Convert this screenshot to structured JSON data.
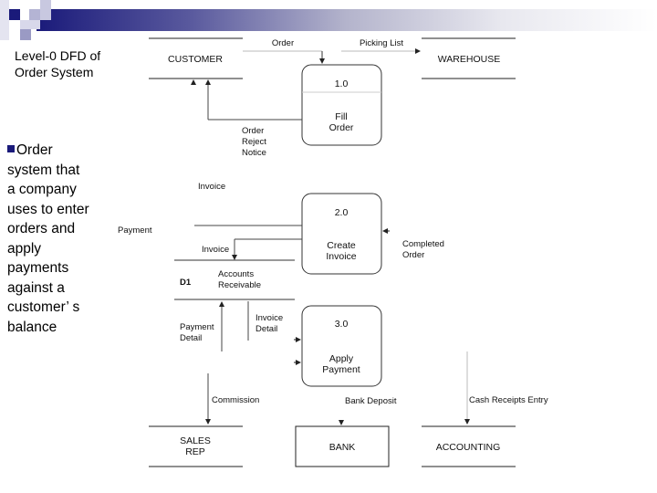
{
  "slide": {
    "title_line1": "Level-0 DFD of",
    "title_line2": "Order System",
    "bullet": "Order system that a company uses to enter orders and apply payments against a customer’ s balance",
    "colors": {
      "accent": "#1a1a7a",
      "line": "#444444"
    }
  },
  "diagram": {
    "entities": {
      "customer": "CUSTOMER",
      "warehouse": "WAREHOUSE",
      "sales_rep_1": "SALES",
      "sales_rep_2": "REP",
      "bank": "BANK",
      "accounting": "ACCOUNTING"
    },
    "processes": [
      {
        "id": "1.0",
        "name1": "Fill",
        "name2": "Order"
      },
      {
        "id": "2.0",
        "name1": "Create",
        "name2": "Invoice"
      },
      {
        "id": "3.0",
        "name1": "Apply",
        "name2": "Payment"
      }
    ],
    "datastore": {
      "id": "D1",
      "name1": "Accounts",
      "name2": "Receivable"
    },
    "flows": {
      "order": "Order",
      "picking_list": "Picking List",
      "order_reject_1": "Order",
      "order_reject_2": "Reject",
      "order_reject_3": "Notice",
      "invoice_top": "Invoice",
      "payment": "Payment",
      "invoice_store": "Invoice",
      "completed_order_1": "Completed",
      "completed_order_2": "Order",
      "payment_detail_1": "Payment",
      "payment_detail_2": "Detail",
      "invoice_detail_1": "Invoice",
      "invoice_detail_2": "Detail",
      "commission": "Commission",
      "bank_deposit": "Bank Deposit",
      "cash_receipts": "Cash Receipts Entry"
    }
  }
}
